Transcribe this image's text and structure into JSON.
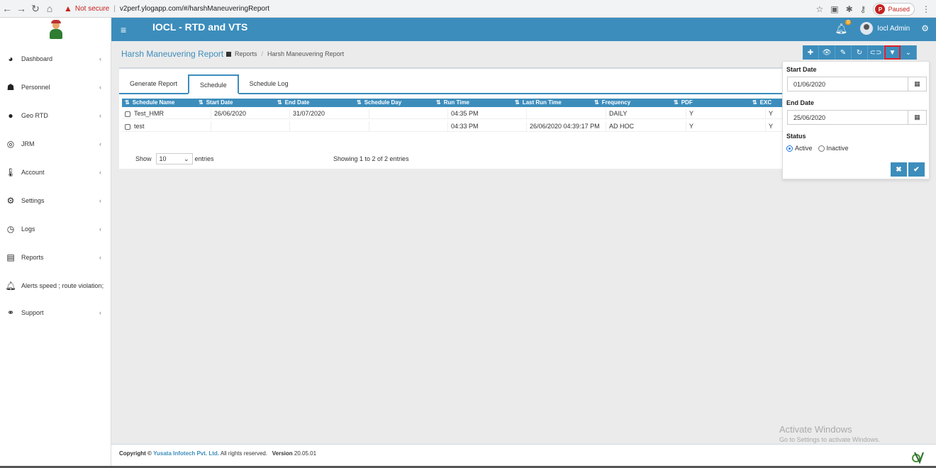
{
  "browser": {
    "warning": "Not secure",
    "url": "v2perf.ylogapp.com/#/harshManeuveringReport",
    "paused": "Paused",
    "paused_initial": "P"
  },
  "header": {
    "title": "IOCL - RTD and VTS",
    "notifications": "0",
    "user_name": "Iocl Admin"
  },
  "sidebar": {
    "items": [
      {
        "label": "Dashboard",
        "icon": "dashboard-icon"
      },
      {
        "label": "Personnel",
        "icon": "users-icon"
      },
      {
        "label": "Geo RTD",
        "icon": "map-marker-icon"
      },
      {
        "label": "JRM",
        "icon": "globe-icon"
      },
      {
        "label": "Account",
        "icon": "thermometer-icon"
      },
      {
        "label": "Settings",
        "icon": "cog-icon"
      },
      {
        "label": "Logs",
        "icon": "clock-icon"
      },
      {
        "label": "Reports",
        "icon": "list-icon"
      },
      {
        "label": "Alerts speed ; route violation;",
        "icon": "bell-icon"
      },
      {
        "label": "Support",
        "icon": "link-icon"
      }
    ]
  },
  "page": {
    "title": "Harsh Maneuvering Report",
    "breadcrumb": [
      "Reports",
      "Harsh Maneuvering Report"
    ]
  },
  "tabs": [
    "Generate Report",
    "Schedule",
    "Schedule Log"
  ],
  "table": {
    "columns": [
      "Schedule Name",
      "Start Date",
      "End Date",
      "Schedule Day",
      "Run Time",
      "Last Run Time",
      "Frequency",
      "PDF",
      "EXC"
    ],
    "rows": [
      {
        "name": "Test_HMR",
        "start": "26/06/2020",
        "end": "31/07/2020",
        "day": "",
        "run": "04:35 PM",
        "last": "",
        "freq": "DAILY",
        "pdf": "Y",
        "exc": "Y"
      },
      {
        "name": "test",
        "start": "",
        "end": "",
        "day": "",
        "run": "04:33 PM",
        "last": "26/06/2020 04:39:17 PM",
        "freq": "AD HOC",
        "pdf": "Y",
        "exc": "Y"
      }
    ],
    "show_label": "Show",
    "entries_value": "10",
    "entries_label": "entries",
    "showing": "Showing 1 to 2 of 2 entries"
  },
  "filter": {
    "start_label": "Start Date",
    "start_value": "01/06/2020",
    "end_label": "End Date",
    "end_value": "25/06/2020",
    "status_label": "Status",
    "options": [
      "Active",
      "Inactive"
    ],
    "selected": "Active"
  },
  "footer": {
    "copyright": "Copyright ©",
    "company": "Yusata Infotech Pvt. Ltd.",
    "rights": "All rights reserved.",
    "version_label": "Version",
    "version": "20.05.01"
  },
  "watermark": {
    "line1": "Activate Windows",
    "line2": "Go to Settings to activate Windows."
  },
  "colors": {
    "primary": "#3c8dbc",
    "highlight": "#e0202a"
  }
}
